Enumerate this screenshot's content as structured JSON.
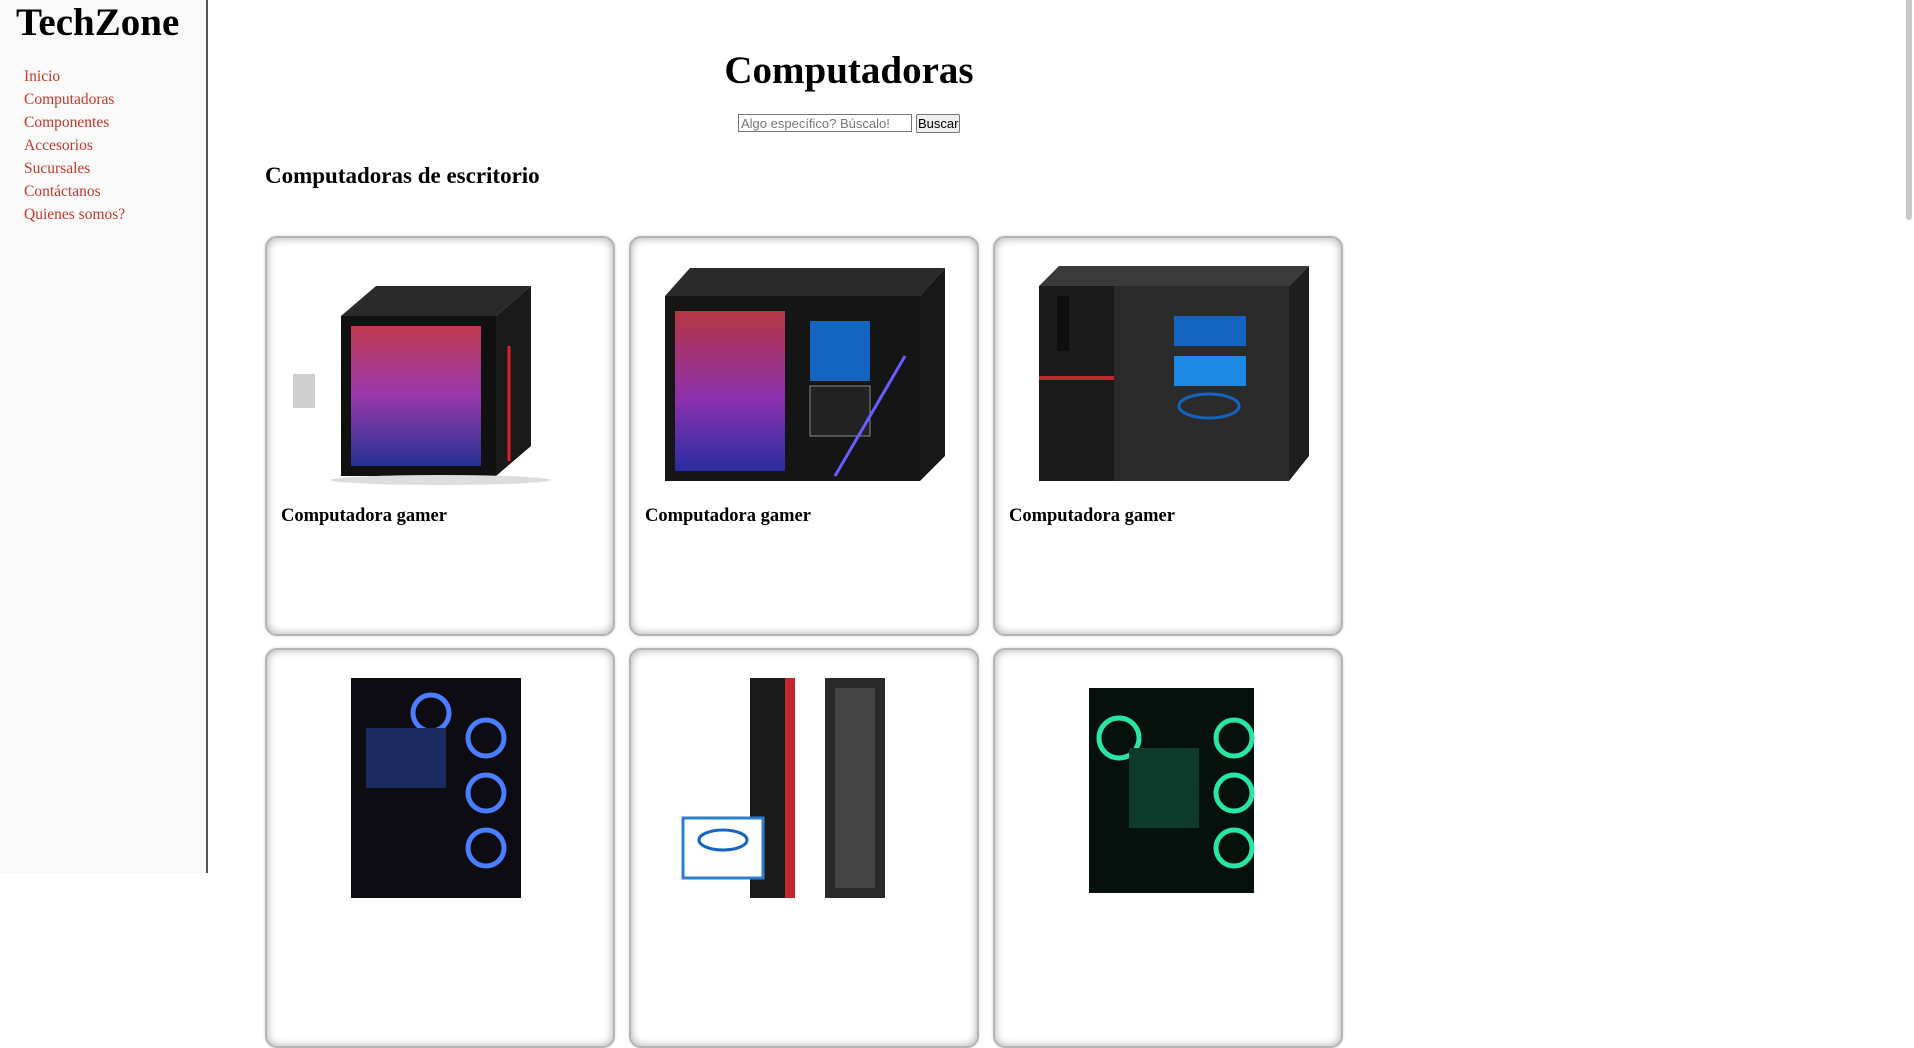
{
  "brand": "TechZone",
  "nav": [
    "Inicio",
    "Computadoras",
    "Componentes",
    "Accesorios",
    "Sucursales",
    "Contáctanos",
    "Quienes somos?"
  ],
  "page_title": "Computadoras",
  "search": {
    "placeholder": "Algo específico? Búscalo!",
    "button": "Buscar"
  },
  "section_title": "Computadoras de escritorio",
  "products": [
    {
      "name": "Computadora gamer",
      "image": "gaming-tower-rgb-side-panel"
    },
    {
      "name": "Computadora gamer",
      "image": "gaming-tower-intel-core-i7-rtx-3060"
    },
    {
      "name": "Computadora gamer",
      "image": "office-tower-intel-core-i7-windows"
    },
    {
      "name": "",
      "image": "gaming-tower-blue-fans"
    },
    {
      "name": "",
      "image": "small-form-factor-intel-core-i7-8th-gen"
    },
    {
      "name": "",
      "image": "gaming-tower-green-fans"
    }
  ],
  "colors": {
    "link": "#c0392b",
    "sidebar_bg": "#f9f9f9"
  }
}
